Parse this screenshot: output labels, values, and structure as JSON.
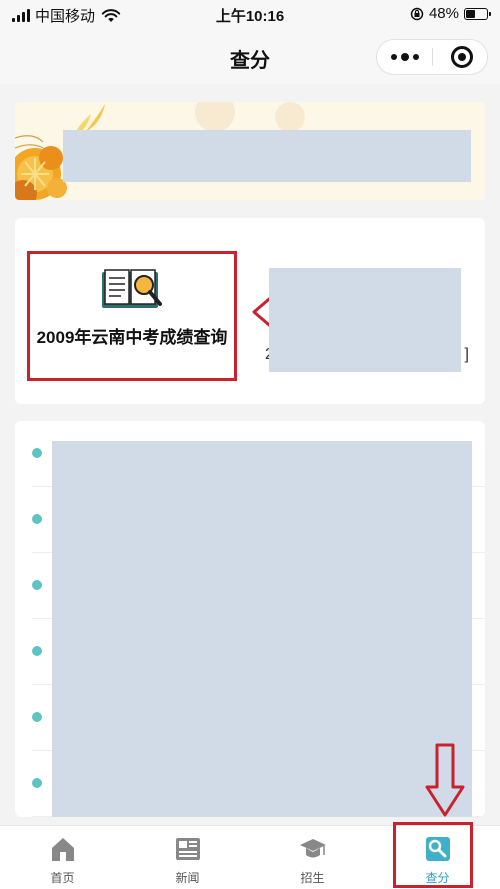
{
  "status_bar": {
    "carrier": "中国移动",
    "time": "上午10:16",
    "battery_text": "48%",
    "battery_level": 0.48
  },
  "nav": {
    "title": "查分"
  },
  "query_tile": {
    "label": "2009年云南中考成绩查询"
  },
  "tile2": {
    "edge_left": "2",
    "edge_right": "]"
  },
  "list": {
    "item_count_visible": 6,
    "accent": "#5ec4c1"
  },
  "tabs": [
    {
      "label": "首页",
      "icon": "home-icon"
    },
    {
      "label": "新闻",
      "icon": "news-icon"
    },
    {
      "label": "招生",
      "icon": "graduation-cap-icon"
    },
    {
      "label": "查分",
      "icon": "score-query-icon",
      "active": true
    }
  ],
  "colors": {
    "annotation_red": "#c8222d",
    "active_tab": "#2f9fbd",
    "redaction": "#d1dbe8"
  }
}
